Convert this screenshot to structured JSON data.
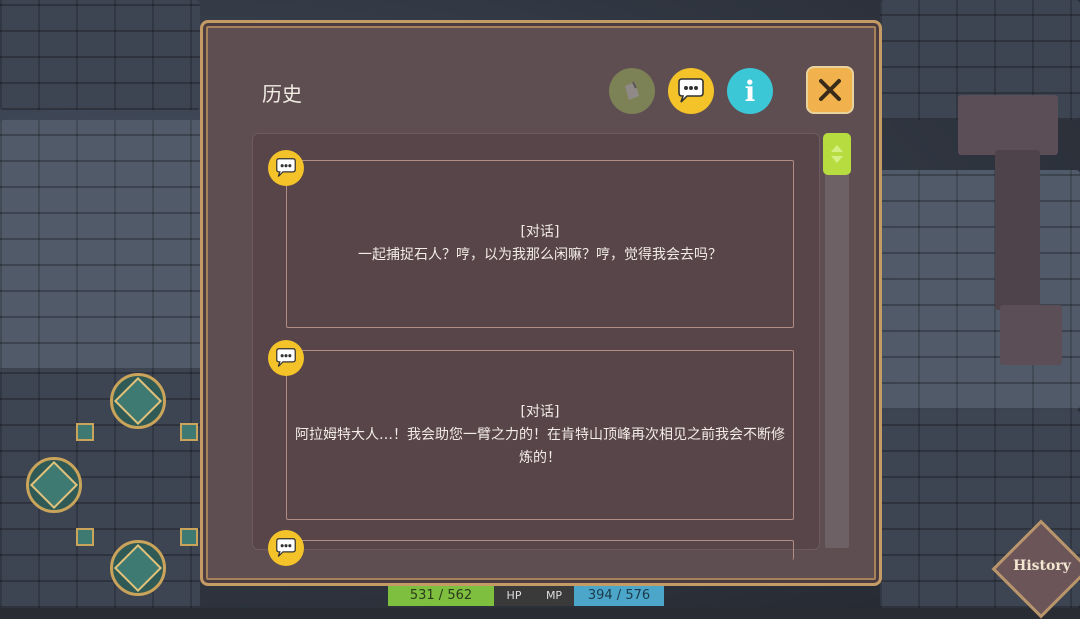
{
  "panel": {
    "title": "历史"
  },
  "toolbar": {
    "filter_icon": "note-icon",
    "chat_icon": "chat-bubble-icon",
    "info_icon": "info-icon",
    "info_glyph": "i",
    "close_icon": "close-icon"
  },
  "entries": [
    {
      "tag": "[对话]",
      "text": "一起捕捉石人？哼，以为我那么闲嘛？哼，觉得我会去吗？"
    },
    {
      "tag": "[对话]",
      "text": "阿拉姆特大人…！我会助您一臂之力的！在肯特山顶峰再次相见之前我会不断修炼的！"
    },
    {
      "tag": "",
      "text": ""
    }
  ],
  "status": {
    "hp_value": "531 / 562",
    "hp_label": "HP",
    "mp_label": "MP",
    "mp_value": "394 / 576"
  },
  "history_button": {
    "label": "History"
  },
  "colors": {
    "accent_yellow": "#f3c329",
    "info_cyan": "#3cc7d6",
    "close_orange": "#f1b24d",
    "panel_bg": "#5e4e52",
    "scroll_thumb": "#b7dc3f"
  }
}
